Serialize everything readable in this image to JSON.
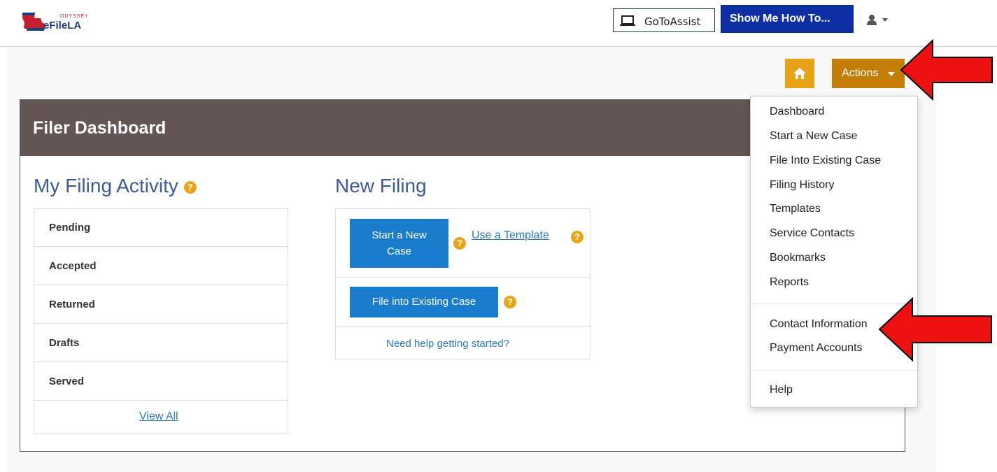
{
  "header": {
    "logo_small": "ODYSSEY",
    "logo_brand": "eFileLA",
    "goto_label": "GoToAssist",
    "showme_label": "Show Me How To..."
  },
  "toolbar": {
    "actions_label": "Actions"
  },
  "dashboard": {
    "title": "Filer Dashboard",
    "activity_title": "My Filing Activity",
    "activity_items": [
      "Pending",
      "Accepted",
      "Returned",
      "Drafts",
      "Served"
    ],
    "view_all": "View All",
    "new_filing_title": "New Filing",
    "start_new_case_line1": "Start a New",
    "start_new_case_line2": "Case",
    "use_template": "Use a Template",
    "file_existing": "File into Existing Case",
    "need_help": "Need help getting started?"
  },
  "menu": {
    "group1": [
      "Dashboard",
      "Start a New Case",
      "File Into Existing Case",
      "Filing History",
      "Templates",
      "Service Contacts",
      "Bookmarks",
      "Reports"
    ],
    "group2": [
      "Contact Information",
      "Payment Accounts"
    ],
    "group3": [
      "Help"
    ]
  },
  "icons": {
    "help": "?",
    "caret": "▾"
  },
  "colors": {
    "home_button": "#e7a316",
    "actions_button": "#c47d05",
    "panel_header": "#625553",
    "primary_blue": "#1a7ccc",
    "showme_blue": "#0c2fa4",
    "arrow_red": "#ee1111"
  }
}
